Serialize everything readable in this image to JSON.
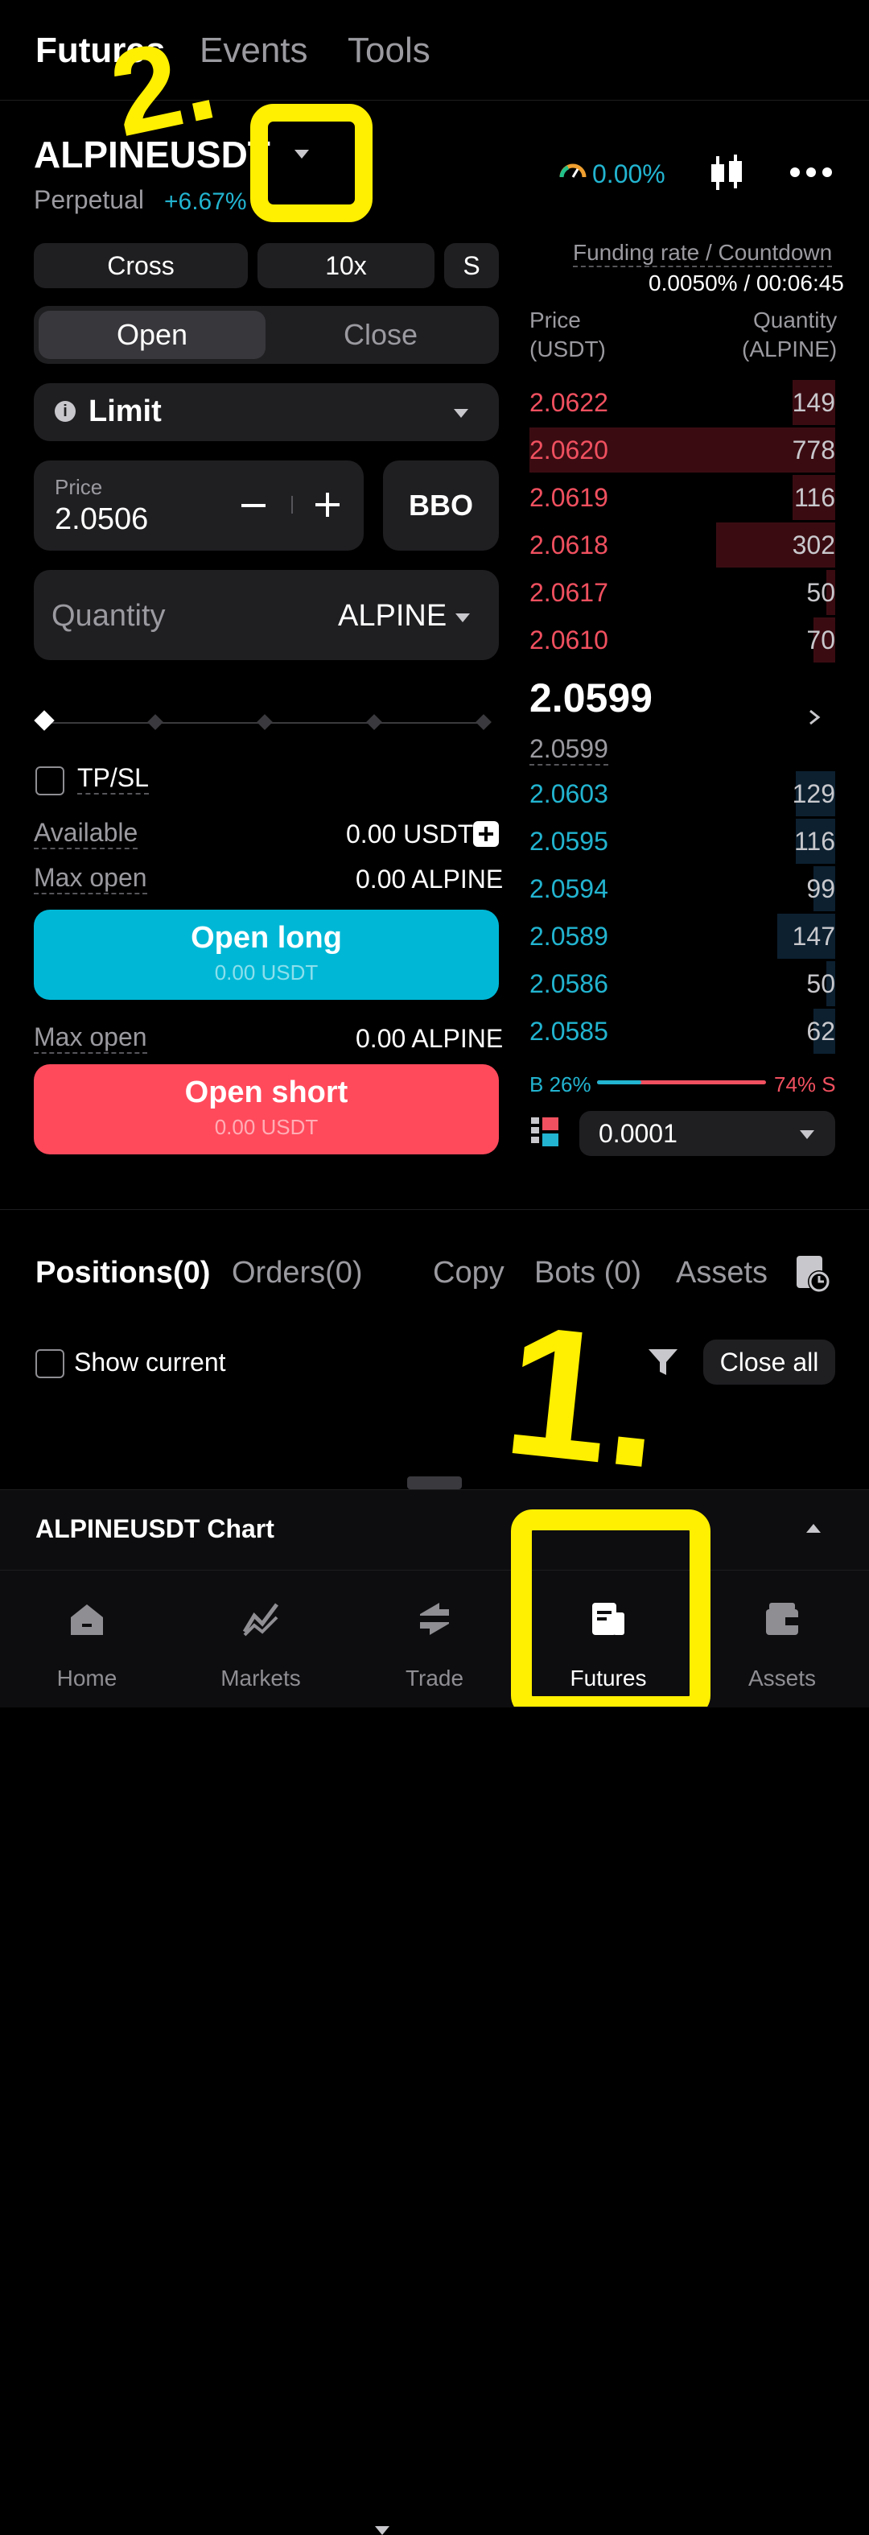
{
  "topnav": {
    "tabs": [
      "Futures",
      "Events",
      "Tools"
    ]
  },
  "header": {
    "pair": "ALPINEUSDT",
    "contract_type": "Perpetual",
    "change": "+6.67%",
    "gauge_value": "0.00%"
  },
  "funding": {
    "label": "Funding rate / Countdown",
    "value": "0.0050% / 00:06:45"
  },
  "order_form": {
    "margin_mode": "Cross",
    "leverage": "10x",
    "mode_short": "S",
    "open_tab": "Open",
    "close_tab": "Close",
    "order_type": "Limit",
    "price_label": "Price",
    "price_value": "2.0506",
    "bbo_label": "BBO",
    "quantity_placeholder": "Quantity",
    "quantity_unit": "ALPINE",
    "tpsl_label": "TP/SL",
    "available_label": "Available",
    "available_value": "0.00 USDT",
    "max_open_label": "Max open",
    "max_open_long": "0.00 ALPINE",
    "max_open_short": "0.00 ALPINE",
    "open_long_label": "Open long",
    "open_long_sub": "0.00 USDT",
    "open_short_label": "Open short",
    "open_short_sub": "0.00 USDT",
    "slider_level": 0
  },
  "orderbook": {
    "price_header": "Price",
    "price_unit": "(USDT)",
    "qty_header": "Quantity",
    "qty_unit": "(ALPINE)",
    "asks": [
      {
        "price": "2.0622",
        "qty": "149",
        "depth": 0.14
      },
      {
        "price": "2.0620",
        "qty": "778",
        "depth": 1.0
      },
      {
        "price": "2.0619",
        "qty": "116",
        "depth": 0.14
      },
      {
        "price": "2.0618",
        "qty": "302",
        "depth": 0.39
      },
      {
        "price": "2.0617",
        "qty": "50",
        "depth": 0.03
      },
      {
        "price": "2.0610",
        "qty": "70",
        "depth": 0.07
      }
    ],
    "last_price": "2.0599",
    "mark_price": "2.0599",
    "bids": [
      {
        "price": "2.0603",
        "qty": "129",
        "depth": 0.13
      },
      {
        "price": "2.0595",
        "qty": "116",
        "depth": 0.13
      },
      {
        "price": "2.0594",
        "qty": "99",
        "depth": 0.07
      },
      {
        "price": "2.0589",
        "qty": "147",
        "depth": 0.19
      },
      {
        "price": "2.0586",
        "qty": "50",
        "depth": 0.03
      },
      {
        "price": "2.0585",
        "qty": "62",
        "depth": 0.07
      }
    ],
    "buy_ratio_label": "B 26%",
    "sell_ratio_label": "74% S",
    "buy_ratio": 0.26,
    "precision": "0.0001"
  },
  "positions": {
    "tabs": [
      "Positions(0)",
      "Orders(0)",
      "Copy",
      "Bots (0)",
      "Assets"
    ],
    "show_current": "Show current",
    "close_all": "Close all"
  },
  "chart_bar": {
    "title": "ALPINEUSDT Chart"
  },
  "annotations": {
    "mark_1": "1.",
    "mark_2": "2."
  },
  "bottom_nav": [
    "Home",
    "Markets",
    "Trade",
    "Futures",
    "Assets"
  ],
  "colors": {
    "ask_red": "#f0505f",
    "bid_cyan": "#22b4d0",
    "long_btn": "#00b8d6",
    "short_btn": "#ff4a5c",
    "highlight_yellow": "#ffef00"
  }
}
